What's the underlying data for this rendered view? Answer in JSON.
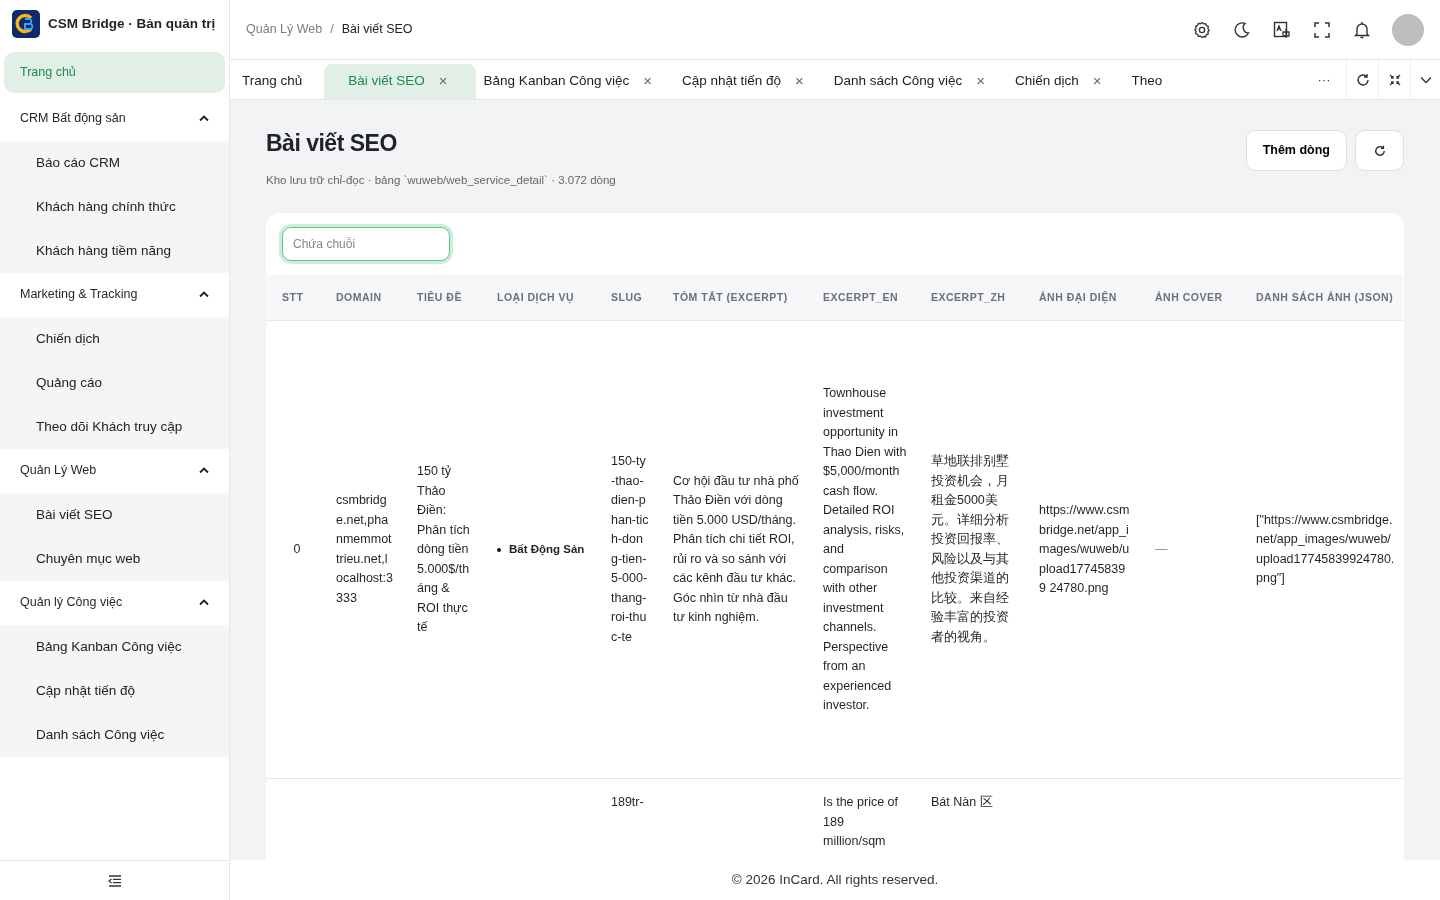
{
  "brand": {
    "title": "CSM Bridge · Bản quản trị"
  },
  "sidebar": {
    "items": [
      {
        "kind": "link",
        "label": "Trang chủ",
        "selected": true
      },
      {
        "kind": "group",
        "label": "CRM Bất động sản",
        "expanded": true,
        "children": [
          {
            "label": "Báo cáo CRM",
            "selected": false
          },
          {
            "label": "Khách hàng chính thức",
            "selected": false
          },
          {
            "label": "Khách hàng tiềm năng",
            "selected": false
          }
        ]
      },
      {
        "kind": "group",
        "label": "Marketing & Tracking",
        "expanded": true,
        "children": [
          {
            "label": "Chiến dịch",
            "selected": false
          },
          {
            "label": "Quảng cáo",
            "selected": false
          },
          {
            "label": "Theo dõi Khách truy cập",
            "selected": false
          }
        ]
      },
      {
        "kind": "group",
        "label": "Quản Lý Web",
        "expanded": true,
        "children": [
          {
            "label": "Bài viết SEO",
            "selected": false
          },
          {
            "label": "Chuyên mục web",
            "selected": false
          }
        ]
      },
      {
        "kind": "group",
        "label": "Quản lý Công việc",
        "expanded": true,
        "children": [
          {
            "label": "Bảng Kanban Công việc",
            "selected": false
          },
          {
            "label": "Cập nhật tiến độ",
            "selected": false
          },
          {
            "label": "Danh sách Công việc",
            "selected": false
          }
        ]
      }
    ]
  },
  "breadcrumb": {
    "items": [
      "Quản Lý Web",
      "Bài viết SEO"
    ],
    "separator": "/"
  },
  "tabs": [
    {
      "label": "Trang chủ",
      "selected": false
    },
    {
      "label": "Bài viết SEO",
      "selected": true,
      "close": "×"
    },
    {
      "label": "Bảng Kanban Công việc",
      "selected": false,
      "close": "×"
    },
    {
      "label": "Cập nhật tiến độ",
      "selected": false,
      "close": "×"
    },
    {
      "label": "Danh sách Công việc",
      "selected": false,
      "close": "×"
    },
    {
      "label": "Chiến dịch",
      "selected": false,
      "close": "×"
    },
    {
      "label": "Theo",
      "selected": false
    }
  ],
  "tab_more": "···",
  "page": {
    "title": "Bài viết SEO",
    "subtitle": "Kho lưu trữ chỉ-đọc · bảng `wuweb/web_service_detail` · 3.072 dòng",
    "add_button": "Thêm dòng"
  },
  "filter": {
    "placeholder": "Chứa chuỗi"
  },
  "table": {
    "columns": [
      "STT",
      "DOMAIN",
      "TIÊU ĐỀ",
      "LOẠI DỊCH VỤ",
      "SLUG",
      "TÓM TẮT (EXCERPT)",
      "EXCERPT_EN",
      "EXCERPT_ZH",
      "ẢNH ĐẠI DIỆN",
      "ẢNH COVER",
      "DANH SÁCH ẢNH (JSON)"
    ],
    "rows": [
      {
        "stt": "0",
        "domain": "csmbridge.net,phanmemmottrieu.net,localhost:3333",
        "title": "150 tỷ Thảo Điền: Phân tích dòng tiền 5.000$/tháng & ROI thực tế",
        "service": "Bất Động Sản",
        "slug": "150-ty-thao-dien-phan-tich-dong-tien-5-000-thang-roi-thuc-te",
        "excerpt": "Cơ hội đầu tư nhà phố Thảo Điền với dòng tiền 5.000 USD/tháng. Phân tích chi tiết ROI, rủi ro và so sánh với các kênh đầu tư khác. Góc nhìn từ nhà đầu tư kinh nghiệm.",
        "excerpt_en": "Townhouse investment opportunity in Thao Dien with $5,000/month cash flow. Detailed ROI analysis, risks, and comparison with other investment channels. Perspective from an experienced investor.",
        "excerpt_zh": "草地联排别墅投资机会，月租金5000美元。详细分析投资回报率、风险以及与其他投资渠道的比较。来自经验丰富的投资者的视角。",
        "avatar": "https://www.csmbridge.net/app_images/wuweb/upload177458399 24780.png",
        "cover": "—",
        "images": "[\"https://www.csmbridge.net/app_images/wuweb/upload17745839924780.png\"]"
      },
      {
        "slug": "189tr-",
        "excerpt_en": "Is the price of 189 million/sqm",
        "excerpt_zh": "Bát Nàn 区"
      }
    ]
  },
  "footer": "© 2026 InCard. All rights reserved."
}
